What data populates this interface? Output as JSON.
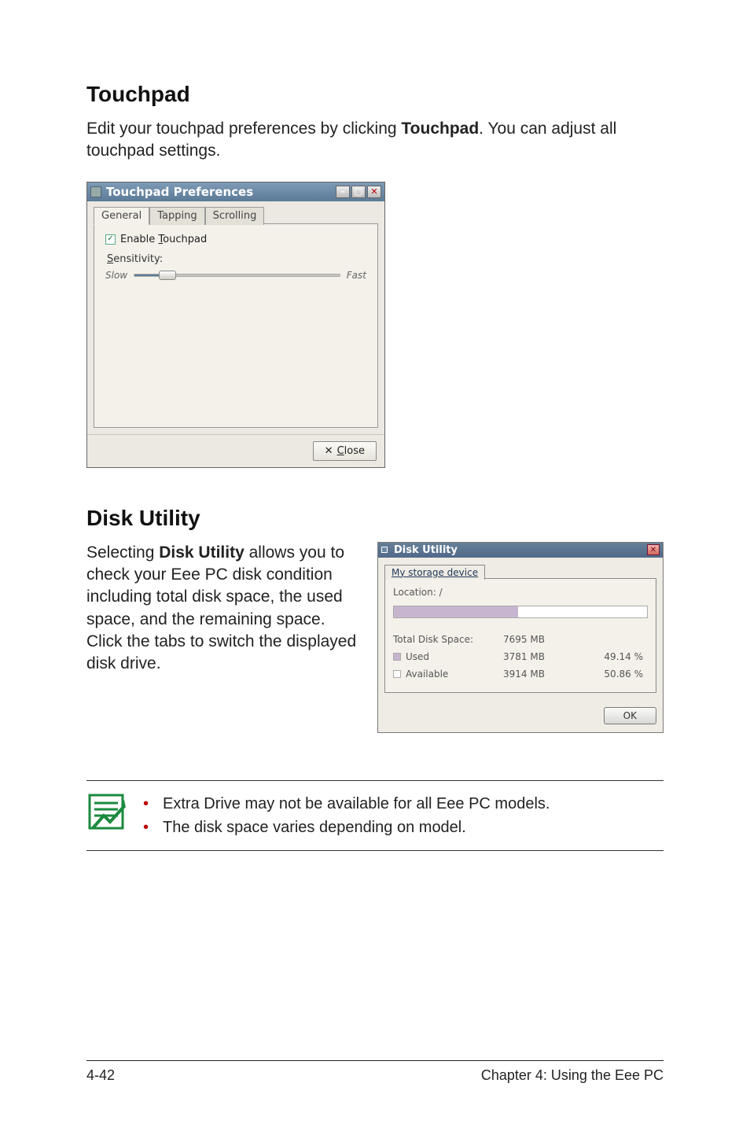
{
  "section1": {
    "heading": "Touchpad",
    "para_a": "Edit your touchpad preferences by clicking ",
    "para_bold": "Touchpad",
    "para_b": ". You can adjust all touchpad settings."
  },
  "tpwin": {
    "title": "Touchpad Preferences",
    "tabs": {
      "general": "General",
      "tapping": "Tapping",
      "scrolling": "Scrolling"
    },
    "enable_pre": "Enable ",
    "enable_ul": "T",
    "enable_post": "ouchpad",
    "sens_ul": "S",
    "sens_post": "ensitivity:",
    "slow": "Slow",
    "fast": "Fast",
    "close_x": "✕",
    "close_ul": "C",
    "close_post": "lose"
  },
  "section2": {
    "heading": "Disk Utility",
    "para_a": "Selecting ",
    "para_bold": "Disk Utility",
    "para_b": " allows you to check your Eee PC disk condition including total disk space, the used space, and the remaining space. Click the tabs to switch the displayed disk drive."
  },
  "duwin": {
    "title": "Disk Utility",
    "tab": "My storage device",
    "location": "Location: /",
    "rows": {
      "total": {
        "label": "Total Disk Space:",
        "value": "7695 MB",
        "pct": ""
      },
      "used": {
        "label": "Used",
        "value": "3781 MB",
        "pct": "49.14 %"
      },
      "available": {
        "label": "Available",
        "value": "3914 MB",
        "pct": "50.86 %"
      }
    },
    "ok": "OK"
  },
  "notes": {
    "n1": "Extra Drive may not be available for all Eee PC models.",
    "n2": "The disk space varies depending on model."
  },
  "footer": {
    "left": "4-42",
    "right": "Chapter 4: Using the Eee PC"
  }
}
